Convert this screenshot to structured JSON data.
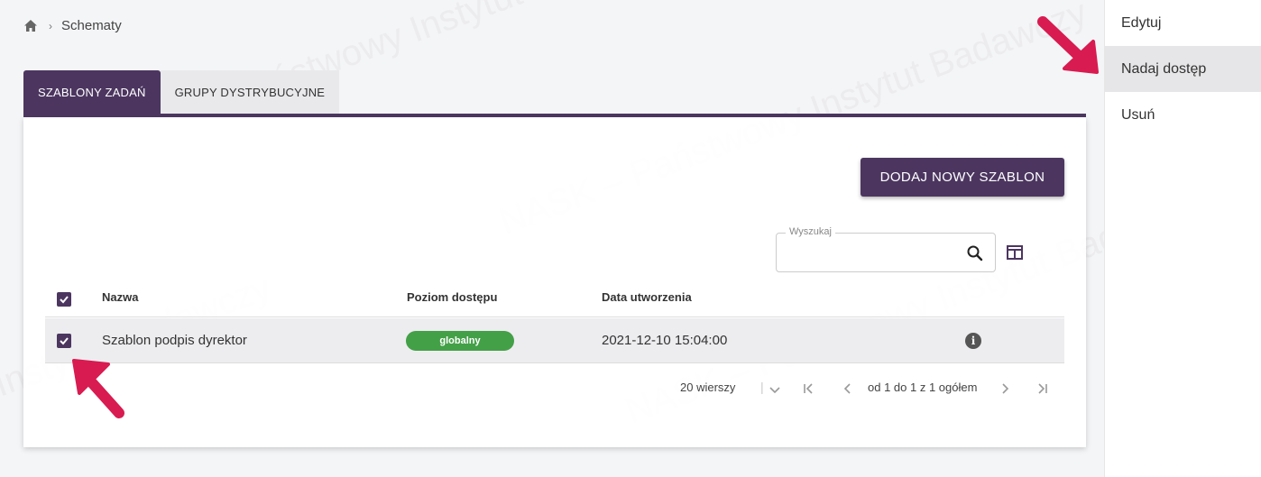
{
  "breadcrumb": {
    "current": "Schematy"
  },
  "tabs": [
    {
      "label": "SZABLONY ZADAŃ",
      "active": true
    },
    {
      "label": "GRUPY DYSTRYBUCYJNE",
      "active": false
    }
  ],
  "toolbar": {
    "add_label": "DODAJ NOWY SZABLON"
  },
  "search": {
    "label": "Wyszukaj",
    "value": ""
  },
  "table": {
    "columns": [
      "Nazwa",
      "Poziom dostępu",
      "Data utworzenia"
    ],
    "rows": [
      {
        "name": "Szablon podpis dyrektor",
        "access": "globalny",
        "created": "2021-12-10 15:04:00",
        "checked": true
      }
    ]
  },
  "pagination": {
    "rows_per_page": "20 wierszy",
    "range": "od 1 do 1 z 1 ogółem"
  },
  "context_menu": {
    "items": [
      "Edytuj",
      "Nadaj dostęp",
      "Usuń"
    ],
    "highlighted": "Nadaj dostęp"
  },
  "colors": {
    "primary": "#4c3660",
    "badge_green": "#43a047",
    "annotation_arrow": "#d81b50"
  }
}
